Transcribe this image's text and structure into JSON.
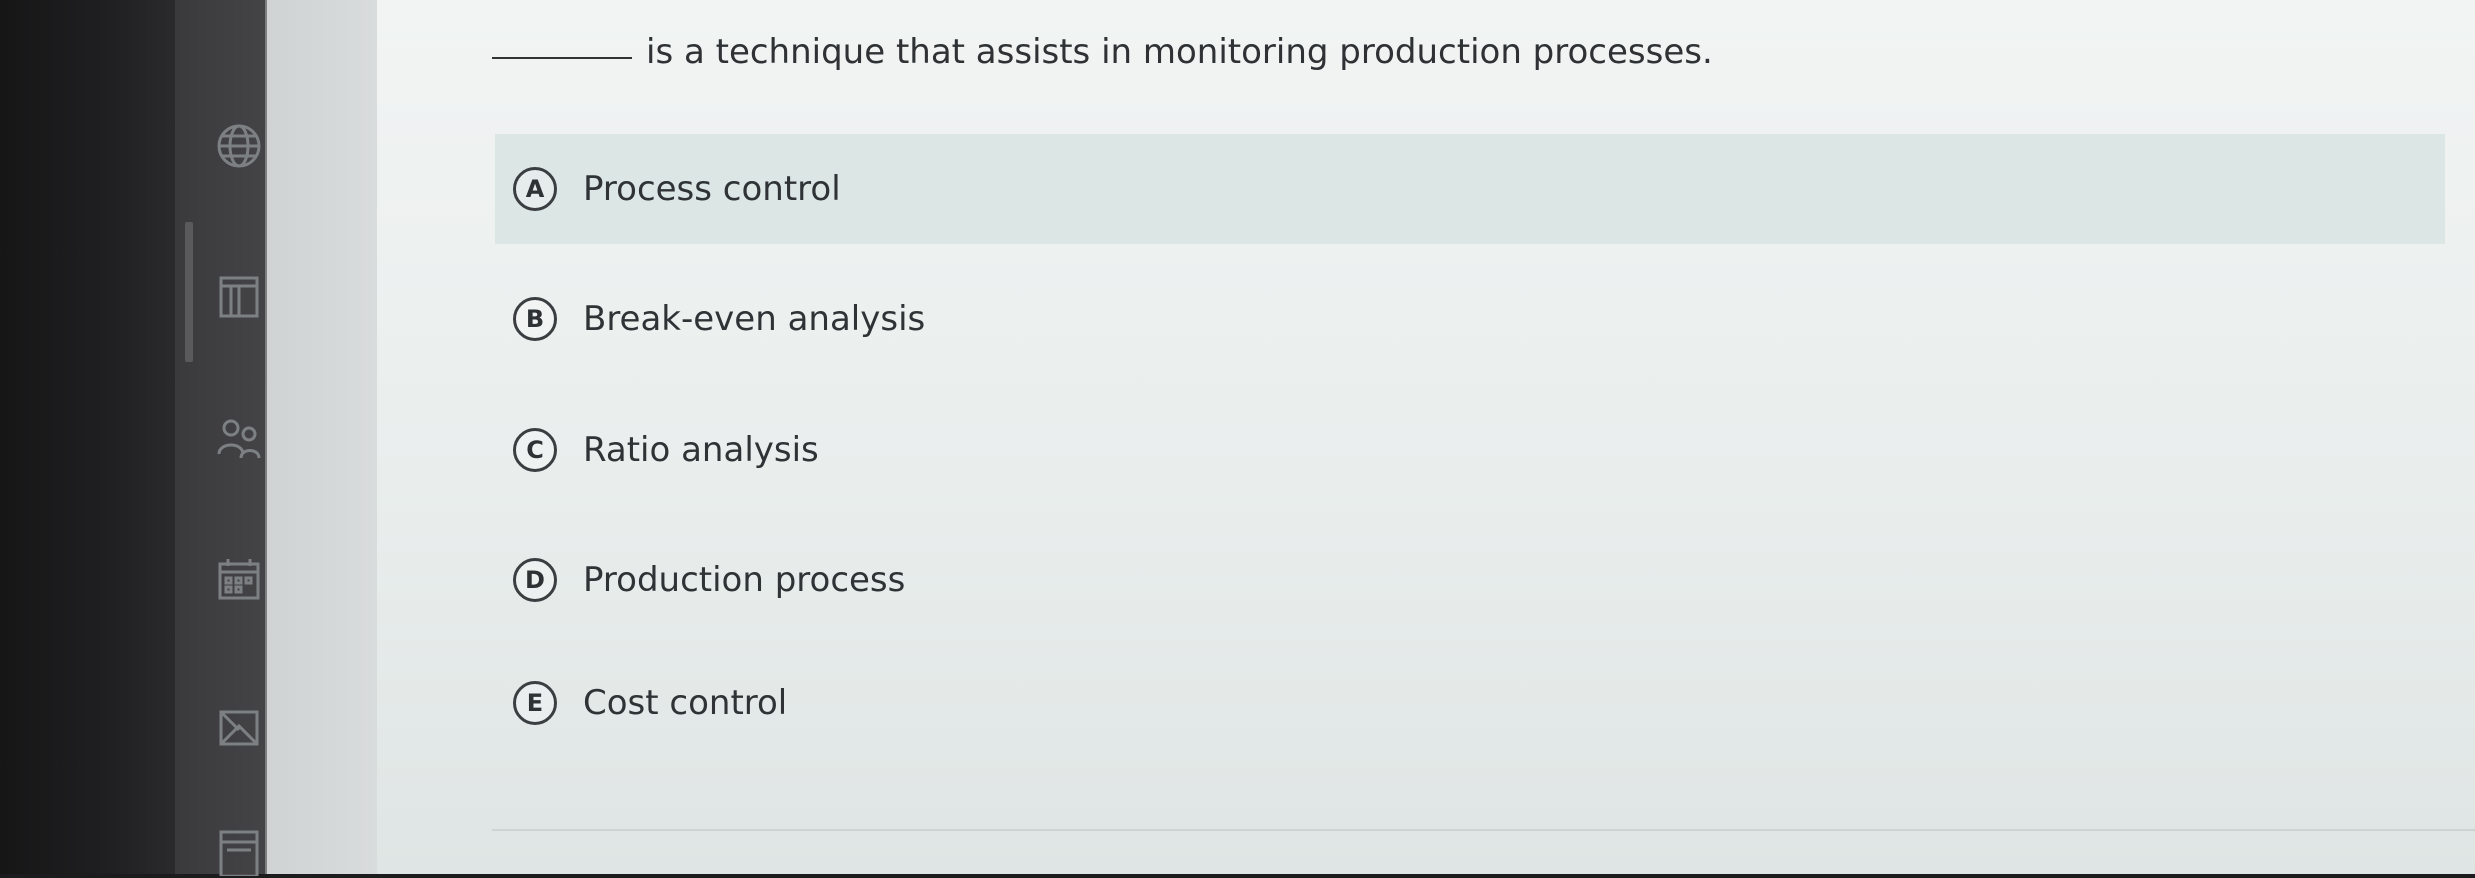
{
  "question": {
    "text": "is a technique that assists in monitoring production processes."
  },
  "options": [
    {
      "letter": "A",
      "label": "Process control"
    },
    {
      "letter": "B",
      "label": "Break-even analysis"
    },
    {
      "letter": "C",
      "label": "Ratio analysis"
    },
    {
      "letter": "D",
      "label": "Production process"
    },
    {
      "letter": "E",
      "label": "Cost control"
    }
  ],
  "sidebar": {
    "icons": [
      "globe-icon",
      "notebook-icon",
      "people-icon",
      "calendar-icon",
      "mail-icon",
      "document-icon"
    ]
  }
}
